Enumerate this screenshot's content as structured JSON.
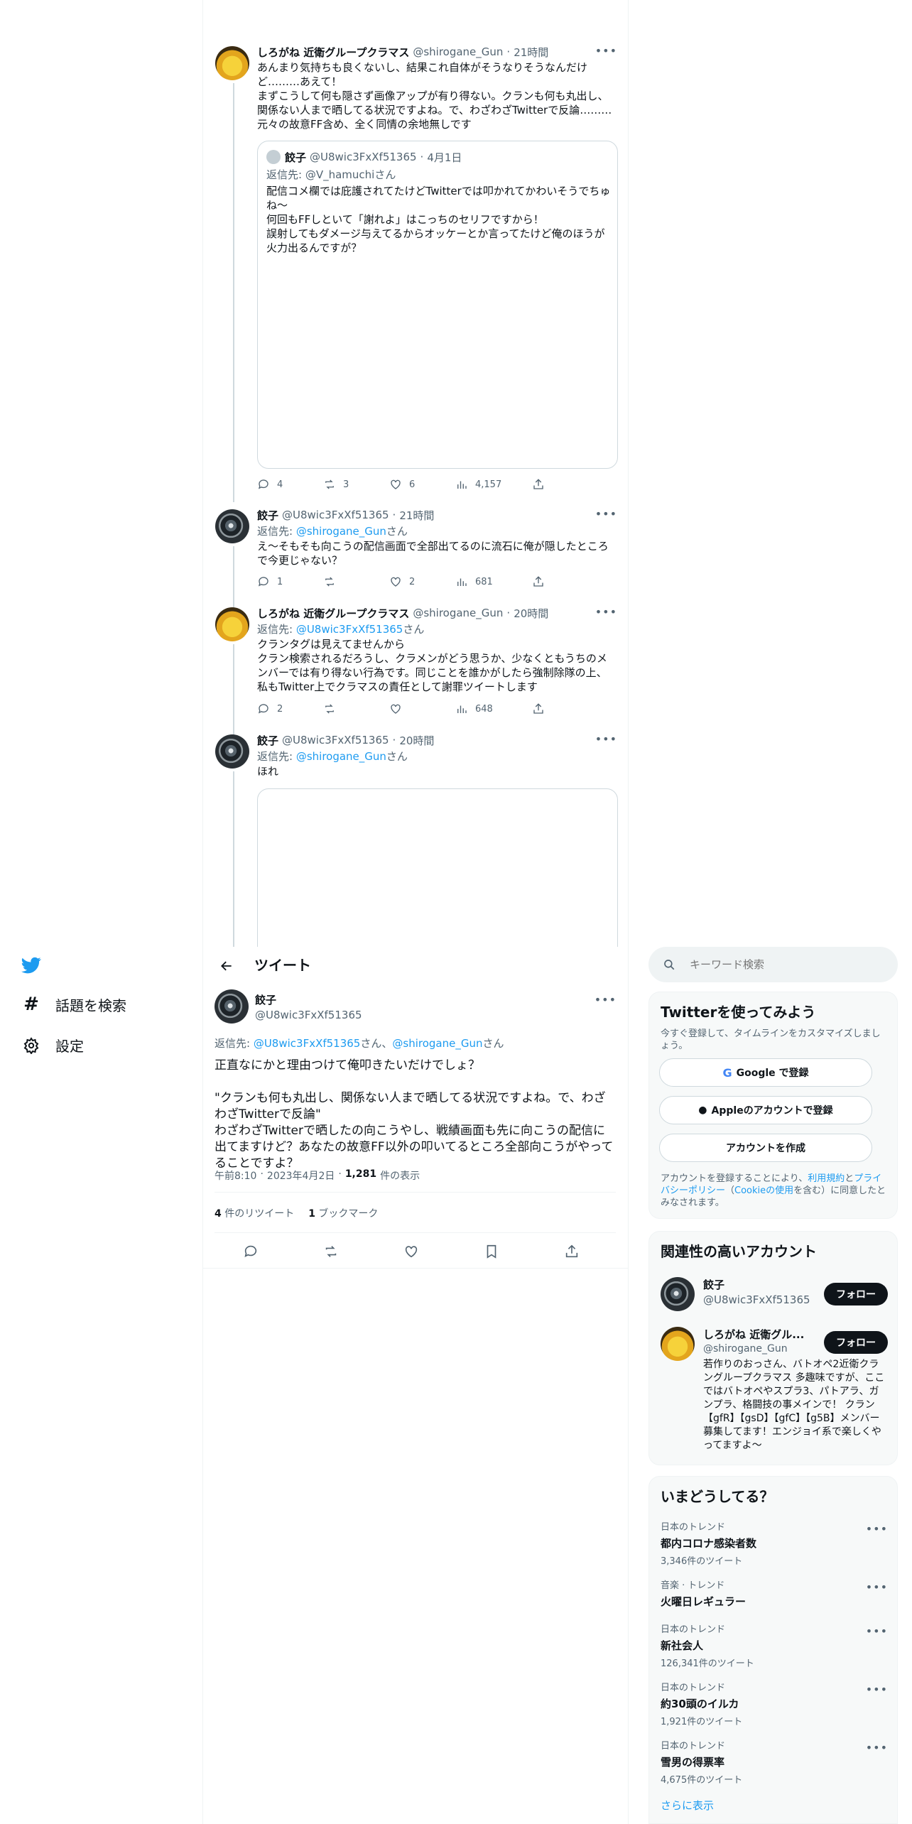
{
  "thread": {
    "tweet1": {
      "name": "しろがね 近衛グループクラマス",
      "handle": "@shirogane_Gun",
      "time": "21時間",
      "text": "あんまり気持ちも良くないし、結果これ自体がそうなりそうなんだけど………あえて！\nまずこうして何も隠さず画像アップが有り得ない。クランも何も丸出し、関係ない人まで晒してる状況ですよね。で、わざわざTwitterで反論………\n元々の故意FF含め、全く同情の余地無しです",
      "quote": {
        "name": "餃子",
        "handle": "@U8wic3FxXf51365",
        "date": "4月1日",
        "reply_prefix": "返信先: ",
        "reply_to": "@V_hamuchiさん",
        "text": "配信コメ欄では庇護されてたけどTwitterでは叩かれてかわいそうでちゅね〜\n何回もFFしといて「謝れよ」はこっちのセリフですから！\n誤射してもダメージ与えてるからオッケーとか言ってたけど俺のほうが火力出るんですが？"
      },
      "stats": {
        "replies": "4",
        "retweets": "3",
        "likes": "6",
        "views": "4,157"
      }
    },
    "tweet2": {
      "name": "餃子",
      "handle": "@U8wic3FxXf51365",
      "time": "21時間",
      "reply_prefix": "返信先: ",
      "reply_to": "@shirogane_Gun",
      "reply_suffix": "さん",
      "text": "え〜そもそも向こうの配信画面で全部出てるのに流石に俺が隠したところで今更じゃない？",
      "stats": {
        "replies": "1",
        "retweets": "",
        "likes": "2",
        "views": "681"
      }
    },
    "tweet3": {
      "name": "しろがね 近衛グループクラマス",
      "handle": "@shirogane_Gun",
      "time": "20時間",
      "reply_prefix": "返信先: ",
      "reply_to": "@U8wic3FxXf51365",
      "reply_suffix": "さん",
      "text": "クランタグは見えてませんから\nクラン検索されるだろうし、クラメンがどう思うか、少なくともうちのメンバーでは有り得ない行為です。同じことを誰かがしたら強制除隊の上、私もTwitter上でクラマスの責任として謝罪ツイートします",
      "stats": {
        "replies": "2",
        "retweets": "",
        "likes": "",
        "views": "648"
      }
    },
    "tweet4": {
      "name": "餃子",
      "handle": "@U8wic3FxXf51365",
      "time": "20時間",
      "reply_prefix": "返信先: ",
      "reply_to": "@shirogane_Gun",
      "reply_suffix": "さん",
      "text": "ほれ"
    }
  },
  "nav": {
    "explore": "話題を検索",
    "settings": "設定"
  },
  "header": {
    "title": "ツイート"
  },
  "main_tweet": {
    "name": "餃子",
    "handle": "@U8wic3FxXf51365",
    "reply_prefix": "返信先: ",
    "reply_to_1": "@U8wic3FxXf51365",
    "reply_mid": "さん、",
    "reply_to_2": "@shirogane_Gun",
    "reply_suffix": "さん",
    "text": "正直なにかと理由つけて俺叩きたいだけでしょ？\n\n\"クランも何も丸出し、関係ない人まで晒してる状況ですよね。で、わざわざTwitterで反論\"\nわざわざTwitterで晒したの向こうやし、戦績画面も先に向こうの配信に出てますけど？あなたの故意FF以外の叩いてるところ全部向こうがやってることですよ？",
    "time": "午前8:10",
    "date": "2023年4月2日",
    "views_count": "1,281",
    "views_label": "件の表示",
    "retweets_count": "4",
    "retweets_label": "件のリツイート",
    "bookmarks_count": "1",
    "bookmarks_label": "ブックマーク"
  },
  "right": {
    "search_placeholder": "キーワード検索",
    "signup": {
      "title": "Twitterを使ってみよう",
      "subtitle": "今すぐ登録して、タイムラインをカスタマイズしましょう。",
      "google": "Google で登録",
      "apple": "Appleのアカウントで登録",
      "create": "アカウントを作成",
      "terms_1": "アカウントを登録することにより、",
      "terms_link1": "利用規約",
      "terms_2": "と",
      "terms_link2": "プライバシーポリシー",
      "terms_3": "（",
      "terms_link3": "Cookieの使用",
      "terms_4": "を含む）に同意したとみなされます。"
    },
    "related": {
      "title": "関連性の高いアカウント",
      "accounts": [
        {
          "name": "餃子",
          "handle": "@U8wic3FxXf51365",
          "follow": "フォロー"
        },
        {
          "name": "しろがね 近衛グル...",
          "handle": "@shirogane_Gun",
          "follow": "フォロー",
          "bio": "若作りのおっさん、バトオペ2近衛クラングループクラマス 多趣味ですが、ここではバトオペやスプラ3、パトアラ、ガンプラ、格闘技の事メインで！ クラン【gfR】【gsD】【gfC】【g5B】メンバー募集してます！エンジョイ系で楽しくやってますよ〜"
        }
      ]
    },
    "trends": {
      "title": "いまどうしてる？",
      "items": [
        {
          "category": "日本のトレンド",
          "name": "都内コロナ感染者数",
          "count": "3,346件のツイート"
        },
        {
          "category": "音楽 · トレンド",
          "name": "火曜日レギュラー",
          "count": ""
        },
        {
          "category": "日本のトレンド",
          "name": "新社会人",
          "count": "126,341件のツイート"
        },
        {
          "category": "日本のトレンド",
          "name": "約30頭のイルカ",
          "count": "1,921件のツイート"
        },
        {
          "category": "日本のトレンド",
          "name": "雪男の得票率",
          "count": "4,675件のツイート"
        }
      ],
      "show_more": "さらに表示"
    }
  },
  "colors": {
    "accent": "#1d9bf0",
    "text": "#0f1419",
    "muted": "#536471",
    "border": "#eff3f4"
  }
}
